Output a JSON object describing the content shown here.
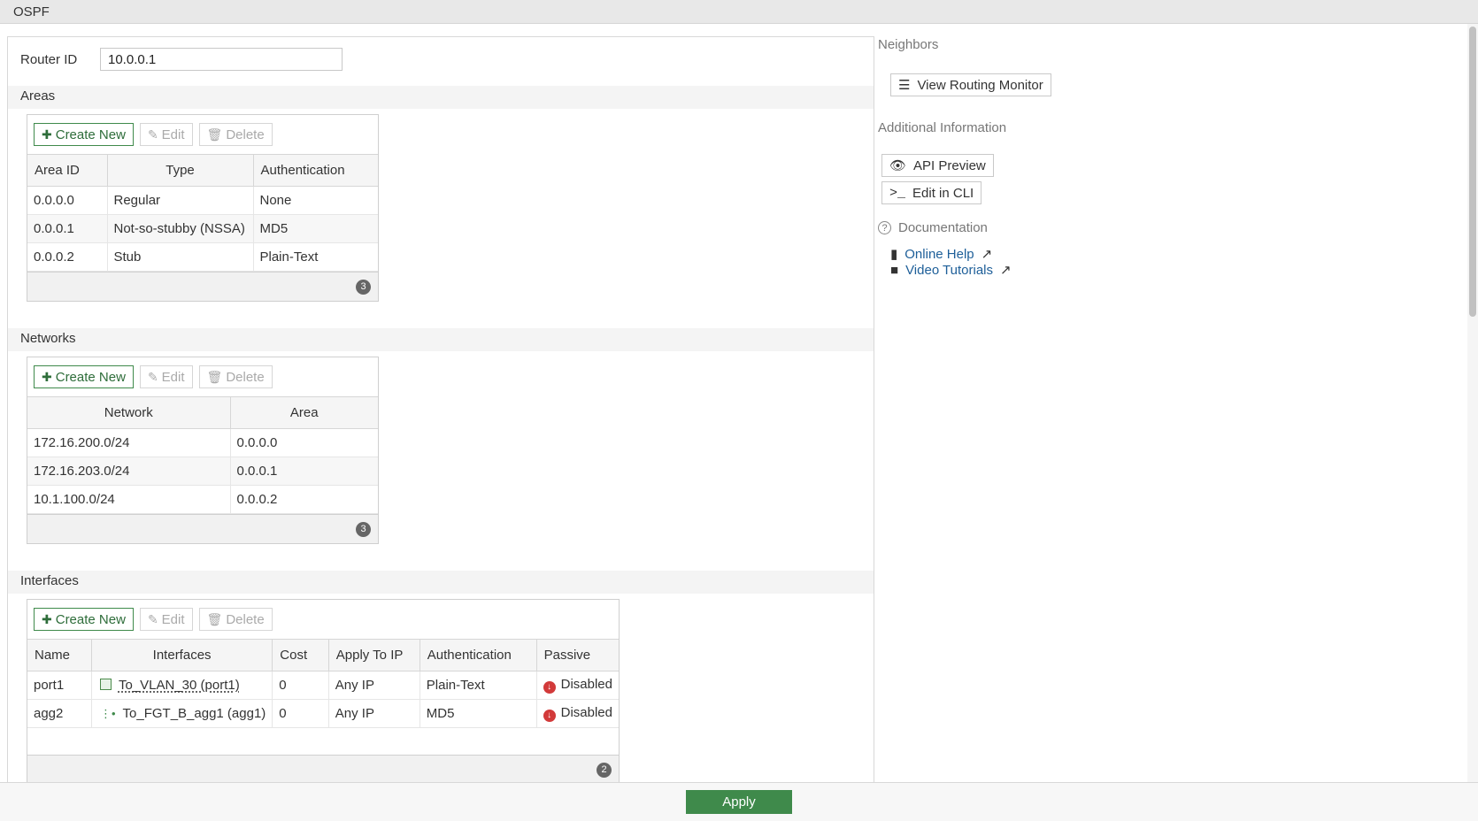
{
  "title": "OSPF",
  "router_id": {
    "label": "Router ID",
    "value": "10.0.0.1"
  },
  "toolbar": {
    "create_new": "Create New",
    "edit": "Edit",
    "delete": "Delete"
  },
  "areas": {
    "header": "Areas",
    "columns": [
      "Area ID",
      "Type",
      "Authentication"
    ],
    "rows": [
      [
        "0.0.0.0",
        "Regular",
        "None"
      ],
      [
        "0.0.0.1",
        "Not-so-stubby (NSSA)",
        "MD5"
      ],
      [
        "0.0.0.2",
        "Stub",
        "Plain-Text"
      ]
    ],
    "count": "3"
  },
  "networks": {
    "header": "Networks",
    "columns": [
      "Network",
      "Area"
    ],
    "rows": [
      [
        "172.16.200.0/24",
        "0.0.0.0"
      ],
      [
        "172.16.203.0/24",
        "0.0.0.1"
      ],
      [
        "10.1.100.0/24",
        "0.0.0.2"
      ]
    ],
    "count": "3"
  },
  "interfaces": {
    "header": "Interfaces",
    "columns": [
      "Name",
      "Interfaces",
      "Cost",
      "Apply To IP",
      "Authentication",
      "Passive"
    ],
    "rows": [
      {
        "name": "port1",
        "interface": "To_VLAN_30 (port1)",
        "cost": "0",
        "apply_to_ip": "Any IP",
        "authentication": "Plain-Text",
        "passive": "Disabled"
      },
      {
        "name": "agg2",
        "interface": "To_FGT_B_agg1 (agg1)",
        "cost": "0",
        "apply_to_ip": "Any IP",
        "authentication": "MD5",
        "passive": "Disabled"
      }
    ],
    "count": "2"
  },
  "sidebar": {
    "neighbors_title": "Neighbors",
    "view_routing_monitor": "View Routing Monitor",
    "additional_info_title": "Additional Information",
    "api_preview": "API Preview",
    "edit_in_cli": "Edit in CLI",
    "documentation_title": "Documentation",
    "online_help": "Online Help",
    "video_tutorials": "Video Tutorials"
  },
  "apply_label": "Apply",
  "colors": {
    "primary_green": "#3f8a4b",
    "link_blue": "#1e5f99",
    "disabled_red": "#d23a3a"
  }
}
